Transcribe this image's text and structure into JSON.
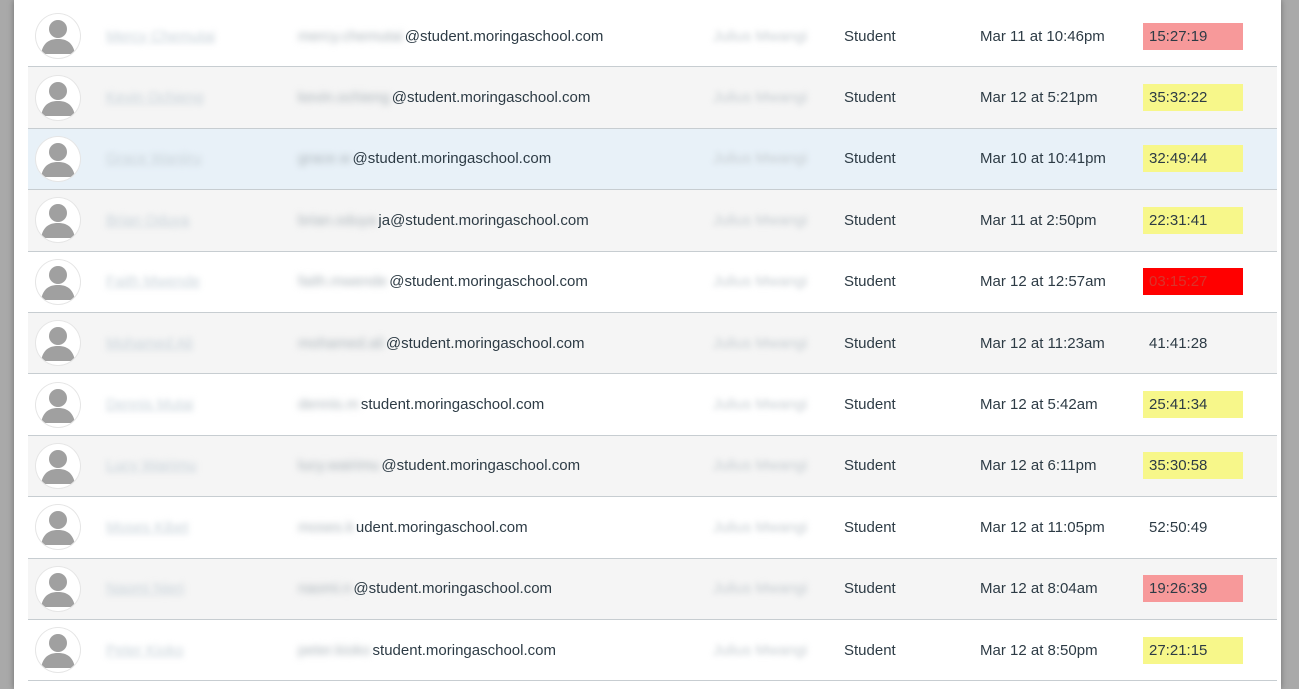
{
  "colors": {
    "pink": "#f7999a",
    "yellow": "#f7f78a",
    "red": "#ff0000",
    "hover_row": "#e8f1f8",
    "even_row": "#f5f5f5"
  },
  "rows": [
    {
      "name": "Mercy Chemutai",
      "email_local": "mercy.chemutai",
      "email_domain": "@student.moringaschool.com",
      "section": "Julius Mwangi",
      "role": "Student",
      "last_activity": "Mar 11 at 10:46pm",
      "total_activity": "15:27:19",
      "highlight": "pink"
    },
    {
      "name": "Kevin Ochieng",
      "email_local": "kevin.ochieng",
      "email_domain": "@student.moringaschool.com",
      "section": "Julius Mwangi",
      "role": "Student",
      "last_activity": "Mar 12 at 5:21pm",
      "total_activity": "35:32:22",
      "highlight": "yellow"
    },
    {
      "name": "Grace Wanjiru",
      "email_local": "grace.w",
      "email_domain": "@student.moringaschool.com",
      "section": "Julius Mwangi",
      "role": "Student",
      "last_activity": "Mar 10 at 10:41pm",
      "total_activity": "32:49:44",
      "highlight": "yellow"
    },
    {
      "name": "Brian Oduya",
      "email_local": "brian.oduya",
      "email_domain": "ja@student.moringaschool.com",
      "section": "Julius Mwangi",
      "role": "Student",
      "last_activity": "Mar 11 at 2:50pm",
      "total_activity": "22:31:41",
      "highlight": "yellow"
    },
    {
      "name": "Faith Mwende",
      "email_local": "faith.mwende",
      "email_domain": "@student.moringaschool.com",
      "section": "Julius Mwangi",
      "role": "Student",
      "last_activity": "Mar 12 at 12:57am",
      "total_activity": "03:15:27",
      "highlight": "red"
    },
    {
      "name": "Mohamed Ali",
      "email_local": "mohamed.ali",
      "email_domain": "@student.moringaschool.com",
      "section": "Julius Mwangi",
      "role": "Student",
      "last_activity": "Mar 12 at 11:23am",
      "total_activity": "41:41:28",
      "highlight": "none"
    },
    {
      "name": "Dennis Mutai",
      "email_local": "dennis.m",
      "email_domain": "student.moringaschool.com",
      "section": "Julius Mwangi",
      "role": "Student",
      "last_activity": "Mar 12 at 5:42am",
      "total_activity": "25:41:34",
      "highlight": "yellow"
    },
    {
      "name": "Lucy Wairimu",
      "email_local": "lucy.wairimu",
      "email_domain": "@student.moringaschool.com",
      "section": "Julius Mwangi",
      "role": "Student",
      "last_activity": "Mar 12 at 6:11pm",
      "total_activity": "35:30:58",
      "highlight": "yellow"
    },
    {
      "name": "Moses Kibet",
      "email_local": "moses.k",
      "email_domain": "udent.moringaschool.com",
      "section": "Julius Mwangi",
      "role": "Student",
      "last_activity": "Mar 12 at 11:05pm",
      "total_activity": "52:50:49",
      "highlight": "none"
    },
    {
      "name": "Naomi Njeri",
      "email_local": "naomi.n",
      "email_domain": "@student.moringaschool.com",
      "section": "Julius Mwangi",
      "role": "Student",
      "last_activity": "Mar 12 at 8:04am",
      "total_activity": "19:26:39",
      "highlight": "pink"
    },
    {
      "name": "Peter Kioko",
      "email_local": "peter.kioko",
      "email_domain": "student.moringaschool.com",
      "section": "Julius Mwangi",
      "role": "Student",
      "last_activity": "Mar 12 at 8:50pm",
      "total_activity": "27:21:15",
      "highlight": "yellow"
    }
  ]
}
